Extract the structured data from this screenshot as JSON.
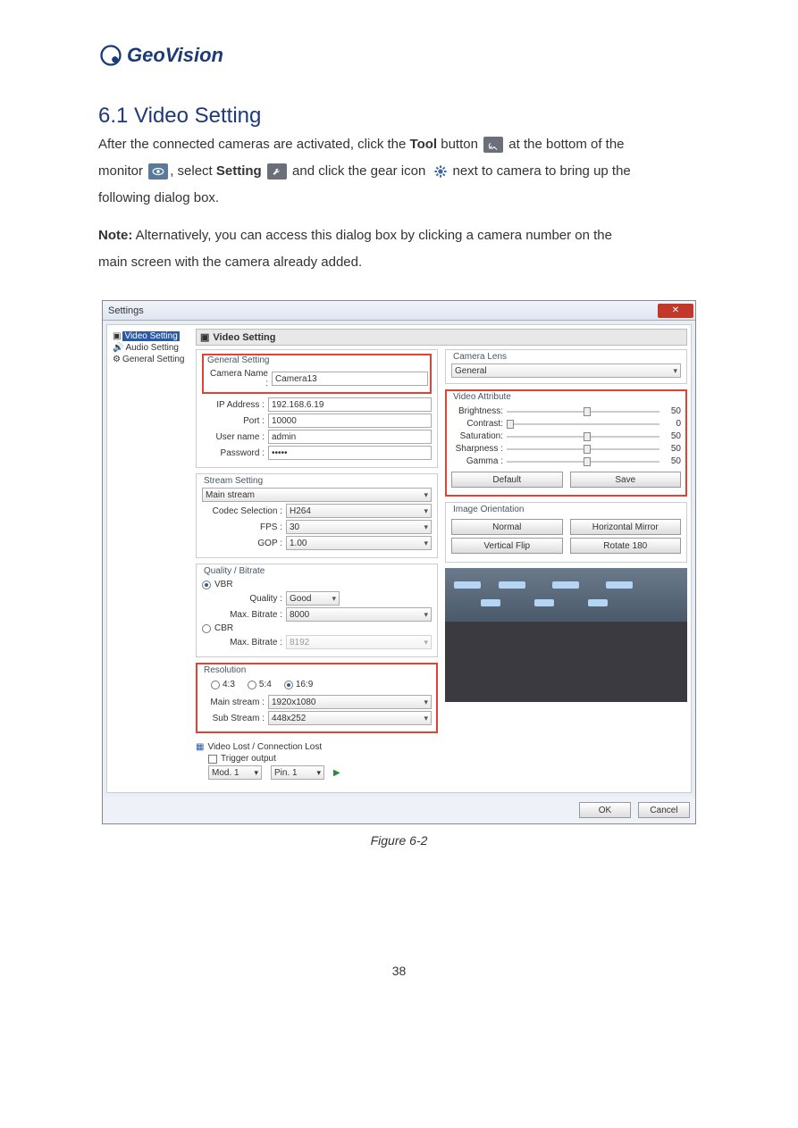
{
  "logo_text": "GeoVision",
  "heading": "6.1 Video Setting",
  "intro_p1_a": "After the connected cameras are activated, click the ",
  "intro_p1_b": "Tool",
  "intro_p1_c": " button ",
  "intro_p1_d": " at the bottom of the ",
  "intro_p2_a": "monitor ",
  "intro_p2_b": ", select ",
  "intro_p2_c": "Setting",
  "intro_p2_e": " and click the gear icon ",
  "intro_p2_f": "next to camera to bring up the ",
  "intro_p3": "following dialog box.",
  "note_label": "Note:",
  "note_text": " Alternatively, you can access this dialog box by clicking a camera number on the ",
  "note_text2": "main screen with the camera already added.",
  "fig_label": "Figure 6-2",
  "page_no": "38",
  "dialog": {
    "title": "Settings",
    "tree": {
      "video": "Video Setting",
      "audio": "Audio Setting",
      "general": "General Setting"
    },
    "panel_title": "Video Setting",
    "general": {
      "legend": "General Setting",
      "camera_name_label": "Camera Name :",
      "camera_name": "Camera13",
      "ip_label": "IP Address :",
      "ip": "192.168.6.19",
      "port_label": "Port :",
      "port": "10000",
      "user_label": "User name :",
      "user": "admin",
      "pass_label": "Password :",
      "pass": "•••••"
    },
    "stream": {
      "legend": "Stream Setting",
      "main": "Main stream",
      "codec_label": "Codec Selection :",
      "codec": "H264",
      "fps_label": "FPS :",
      "fps": "30",
      "gop_label": "GOP :",
      "gop": "1.00"
    },
    "bitrate": {
      "legend": "Quality / Bitrate",
      "vbr": "VBR",
      "quality_label": "Quality :",
      "quality": "Good",
      "max_label": "Max. Bitrate :",
      "max": "8000",
      "cbr": "CBR",
      "max2_label": "Max. Bitrate :",
      "max2": "8192"
    },
    "res": {
      "legend": "Resolution",
      "r43": "4:3",
      "r54": "5:4",
      "r169": "16:9",
      "main_label": "Main stream :",
      "main": "1920x1080",
      "sub_label": "Sub Stream :",
      "sub": "448x252"
    },
    "lost": {
      "legend": "Video Lost / Connection Lost",
      "trigger": "Trigger output",
      "mod": "Mod. 1",
      "pin": "Pin. 1"
    },
    "lens": {
      "legend": "Camera Lens",
      "val": "General"
    },
    "attr": {
      "legend": "Video Attribute",
      "brightness": "Brightness:",
      "brightness_v": "50",
      "contrast": "Contrast:",
      "contrast_v": "0",
      "saturation": "Saturation:",
      "saturation_v": "50",
      "sharpness": "Sharpness :",
      "sharpness_v": "50",
      "gamma": "Gamma :",
      "gamma_v": "50",
      "default_btn": "Default",
      "save_btn": "Save"
    },
    "orient": {
      "legend": "Image Orientation",
      "normal": "Normal",
      "hmirror": "Horizontal Mirror",
      "vflip": "Vertical Flip",
      "r180": "Rotate 180"
    },
    "footer": {
      "ok": "OK",
      "cancel": "Cancel"
    }
  }
}
